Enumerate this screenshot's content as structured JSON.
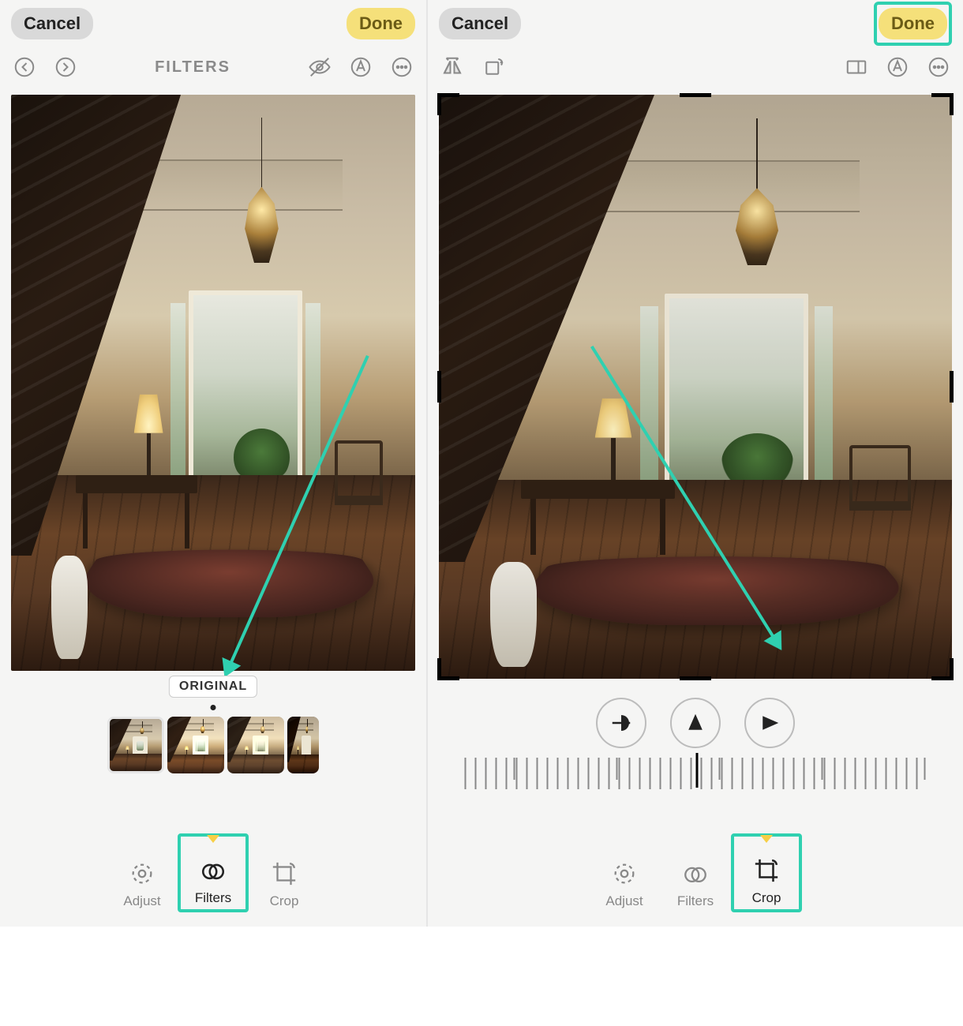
{
  "left": {
    "cancel": "Cancel",
    "done": "Done",
    "mode_title": "FILTERS",
    "filter_label": "ORIGINAL",
    "tabs": {
      "adjust": "Adjust",
      "filters": "Filters",
      "crop": "Crop"
    }
  },
  "right": {
    "cancel": "Cancel",
    "done": "Done",
    "tabs": {
      "adjust": "Adjust",
      "filters": "Filters",
      "crop": "Crop"
    }
  },
  "icons": {
    "undo": "undo-icon",
    "redo": "redo-icon",
    "visibility": "visibility-off-icon",
    "markup": "markup-icon",
    "more": "more-icon",
    "fliph": "flip-horizontal-icon",
    "rotate": "rotate-icon",
    "aspect": "aspect-ratio-icon",
    "straighten": "straighten-icon",
    "vert": "vertical-perspective-icon",
    "horiz": "horizontal-perspective-icon",
    "adjust": "adjust-icon",
    "filters": "filters-icon",
    "crop": "crop-icon"
  }
}
